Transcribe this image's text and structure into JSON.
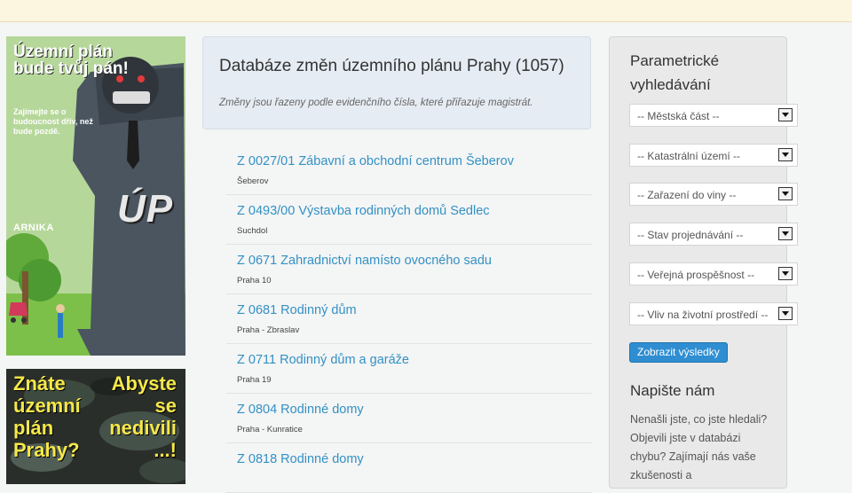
{
  "banner_left": {
    "headline": "Územní plán bude tvůj pán!",
    "subline": "Zajímejte se o budoucnost dřív, než bude pozdě.",
    "logo": "ARNIKA",
    "badge": "ÚP"
  },
  "banner_left2": {
    "left_text": "Znáte územní plán Prahy?",
    "right_text": "Abyste se nedivili ...!"
  },
  "header": {
    "title": "Databáze změn územního plánu Prahy (1057)",
    "subtitle": "Změny jsou řazeny podle evidenčního čísla, které přiřazuje magistrát."
  },
  "records": [
    {
      "title": "Z 0027/01 Zábavní a obchodní centrum Šeberov",
      "location": "Šeberov"
    },
    {
      "title": "Z 0493/00 Výstavba rodinných domů Sedlec",
      "location": "Suchdol"
    },
    {
      "title": "Z 0671 Zahradnictví namísto ovocného sadu",
      "location": "Praha 10"
    },
    {
      "title": "Z 0681 Rodinný dům",
      "location": "Praha - Zbraslav"
    },
    {
      "title": "Z 0711 Rodinný dům a garáže",
      "location": "Praha 19"
    },
    {
      "title": "Z 0804 Rodinné domy",
      "location": "Praha - Kunratice"
    },
    {
      "title": "Z 0818 Rodinné domy",
      "location": ""
    }
  ],
  "sidebar": {
    "title": "Parametrické vyhledávání",
    "filters": [
      "-- Městská část --",
      "-- Katastrální území --",
      "-- Zařazení do viny --",
      "-- Stav projednávání --",
      "-- Veřejná prospěšnost --",
      "-- Vliv na životní prostředí --"
    ],
    "button_label": "Zobrazit výsledky",
    "contact_title": "Napište nám",
    "contact_text": "Nenašli jste, co jste hledali? Objevili jste v databázi chybu? Zajímají nás vaše zkušenosti a"
  },
  "colors": {
    "link": "#3391c4",
    "button": "#2f8ed1",
    "header_bg": "#e6ecf3",
    "banner2_text": "#f6e84a"
  }
}
